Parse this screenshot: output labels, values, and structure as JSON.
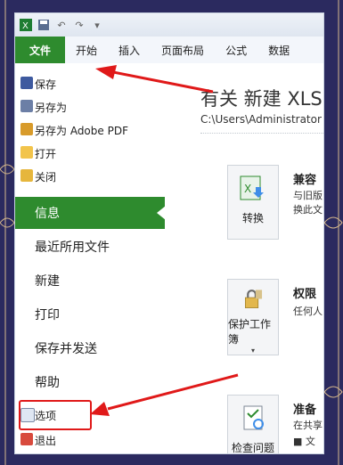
{
  "quick_access": {
    "icons": [
      "excel-icon",
      "save-icon",
      "undo-icon",
      "redo-icon",
      "customize-icon"
    ]
  },
  "ribbon": {
    "tabs": [
      "文件",
      "开始",
      "插入",
      "页面布局",
      "公式",
      "数据"
    ]
  },
  "file_menu": {
    "items": [
      {
        "label": "保存",
        "icon": "save-icon"
      },
      {
        "label": "另存为",
        "icon": "save-as-icon"
      },
      {
        "label": "另存为 Adobe PDF",
        "icon": "pdf-icon"
      },
      {
        "label": "打开",
        "icon": "open-folder-icon"
      },
      {
        "label": "关闭",
        "icon": "close-folder-icon"
      }
    ],
    "sections": [
      "信息",
      "最近所用文件",
      "新建",
      "打印",
      "保存并发送",
      "帮助"
    ],
    "bottom_items": [
      {
        "label": "选项",
        "icon": "options-icon"
      },
      {
        "label": "退出",
        "icon": "exit-icon"
      }
    ]
  },
  "info": {
    "title": "有关 新建 XLS",
    "path": "C:\\Users\\Administrator",
    "cards": [
      {
        "label": "转换",
        "heading": "兼容",
        "desc1": "与旧版",
        "desc2": "换此文"
      },
      {
        "label": "保护工作簿",
        "heading": "权限",
        "desc1": "任何人"
      },
      {
        "label": "检查问题",
        "heading": "准备",
        "desc1": "在共享",
        "desc2": "■  文"
      }
    ]
  },
  "colors": {
    "accent": "#2e8b2e",
    "annotation": "#e01919",
    "background": "#2b2a5f"
  }
}
